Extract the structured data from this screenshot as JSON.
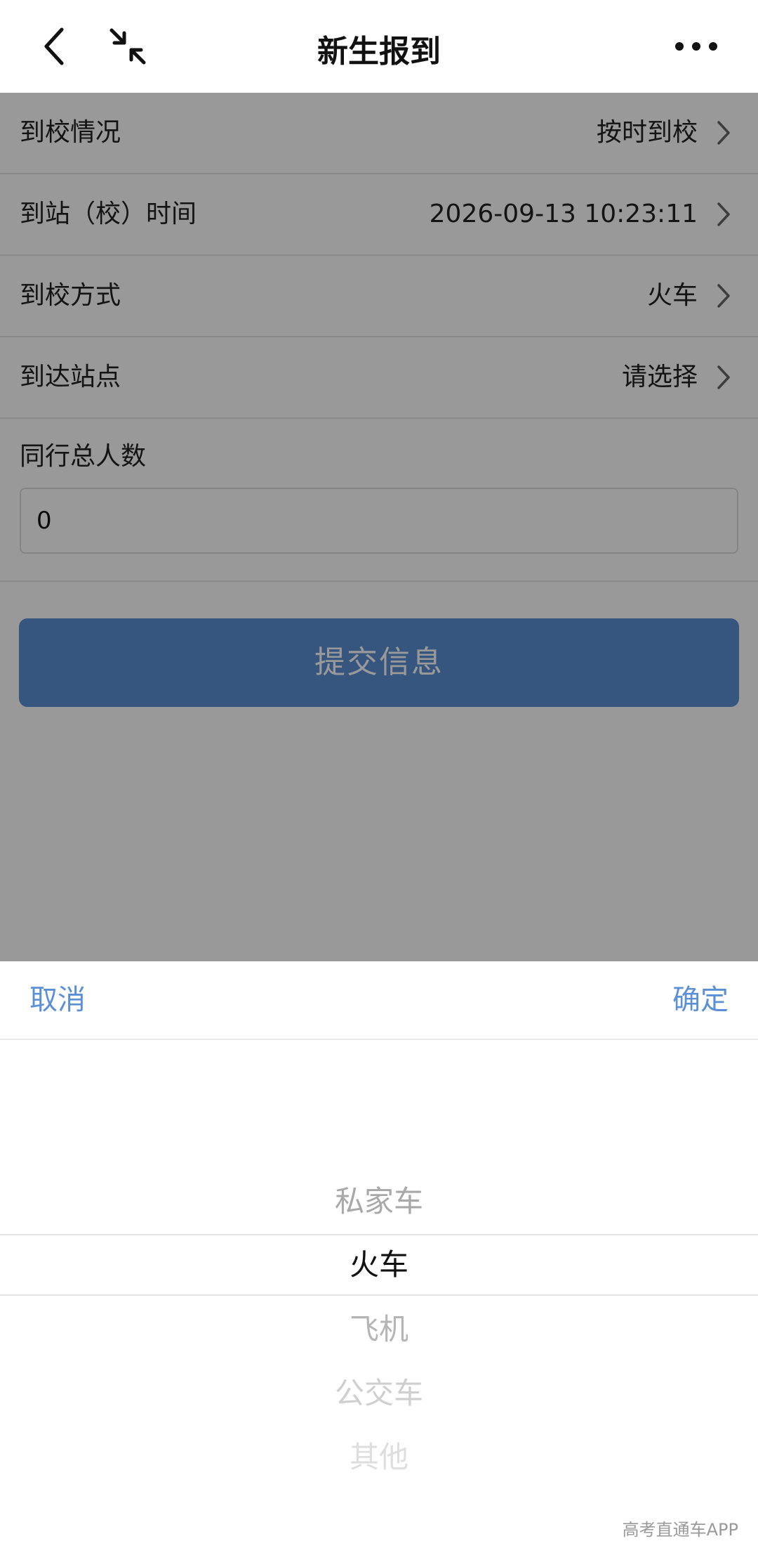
{
  "header": {
    "title": "新生报到"
  },
  "form": {
    "rows": [
      {
        "label": "到校情况",
        "value": "按时到校"
      },
      {
        "label": "到站（校）时间",
        "value": "2026-09-13 10:23:11"
      },
      {
        "label": "到校方式",
        "value": "火车"
      },
      {
        "label": "到达站点",
        "value": "请选择"
      }
    ],
    "companion": {
      "label": "同行总人数",
      "value": "0"
    },
    "submit_label": "提交信息"
  },
  "picker": {
    "cancel_label": "取消",
    "confirm_label": "确定",
    "options": [
      "私家车",
      "火车",
      "飞机",
      "公交车",
      "其他"
    ],
    "selected": "火车"
  },
  "watermark": "高考直通车APP",
  "colors": {
    "accent": "#5b8fd6",
    "overlay": "rgba(0,0,0,0.4)"
  },
  "icons": [
    "back-arrow-icon",
    "collapse-icon",
    "more-icon",
    "chevron-right-icon"
  ]
}
